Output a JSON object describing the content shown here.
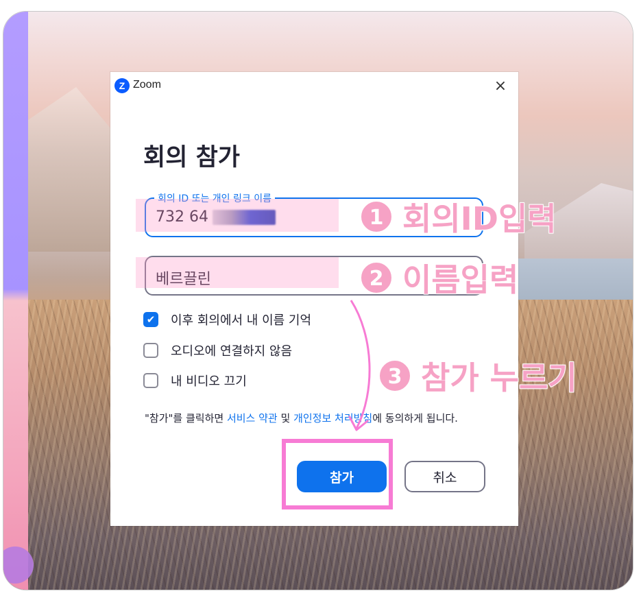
{
  "window": {
    "app_title": "Zoom",
    "logo_letter": "Z",
    "close_icon": "×"
  },
  "dialog": {
    "heading": "회의 참가",
    "meeting_id": {
      "label": "회의 ID 또는 개인 링크 이름",
      "value_visible": "732 64"
    },
    "name_field": {
      "value": "베르끌린"
    },
    "options": [
      {
        "label": "이후 회의에서 내 이름 기억",
        "checked": true
      },
      {
        "label": "오디오에 연결하지 않음",
        "checked": false
      },
      {
        "label": "내 비디오 끄기",
        "checked": false
      }
    ],
    "terms": {
      "prefix": "\"참가\"를 클릭하면 ",
      "link_service": "서비스 약관",
      "middle": " 및 ",
      "link_privacy": "개인정보 처리방침",
      "suffix": "에 동의하게 됩니다."
    },
    "buttons": {
      "join": "참가",
      "cancel": "취소"
    }
  },
  "annotations": {
    "step1": {
      "num": "1",
      "text": "회의ID입력"
    },
    "step2": {
      "num": "2",
      "text": "이름입력"
    },
    "step3": {
      "num": "3",
      "text": "참가 누르기"
    }
  },
  "colors": {
    "accent": "#0e72ed",
    "annotation_pink": "#f6a2c5",
    "highlight_border": "#f77bd4"
  }
}
